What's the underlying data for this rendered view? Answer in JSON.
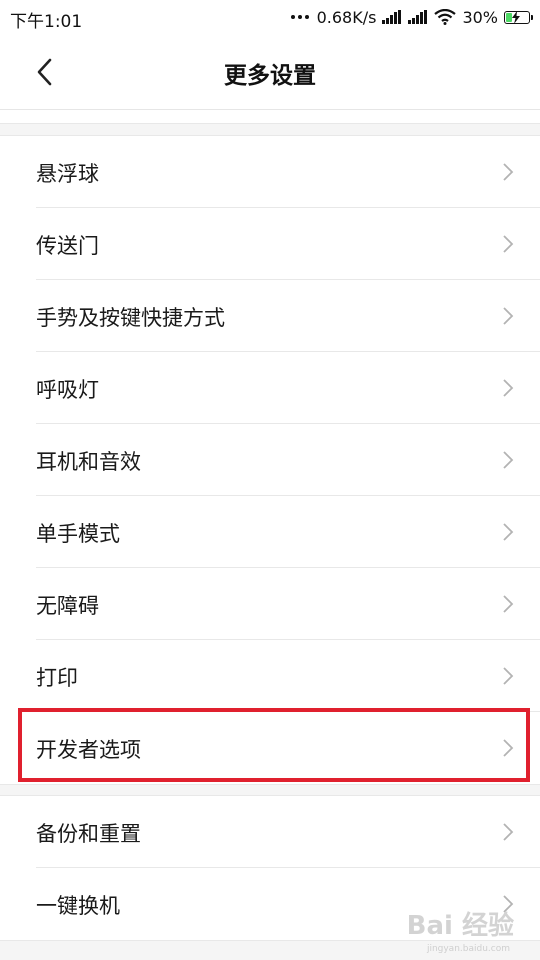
{
  "status_bar": {
    "time": "下午1:01",
    "network_speed": "0.68K/s",
    "battery_percent": "30%",
    "battery_level": 0.3,
    "battery_color": "#4cd964",
    "icons": [
      "more-dots-icon",
      "signal-icon",
      "signal-icon",
      "wifi-icon",
      "battery-charging-icon"
    ]
  },
  "header": {
    "back_icon": "chevron-left-icon",
    "title": "更多设置"
  },
  "groups": [
    {
      "items": [
        {
          "id": "floating-ball",
          "label": "悬浮球"
        },
        {
          "id": "portal",
          "label": "传送门"
        },
        {
          "id": "gestures-shortcuts",
          "label": "手势及按键快捷方式"
        },
        {
          "id": "breathing-light",
          "label": "呼吸灯"
        },
        {
          "id": "headphones-audio",
          "label": "耳机和音效"
        },
        {
          "id": "one-hand-mode",
          "label": "单手模式"
        },
        {
          "id": "accessibility",
          "label": "无障碍"
        },
        {
          "id": "print",
          "label": "打印"
        },
        {
          "id": "developer-options",
          "label": "开发者选项"
        }
      ]
    },
    {
      "items": [
        {
          "id": "backup-reset",
          "label": "备份和重置"
        },
        {
          "id": "mi-mover",
          "label": "一键换机"
        }
      ]
    }
  ],
  "highlight": {
    "target": "developer-options",
    "color": "#e0202e"
  },
  "watermark": {
    "text": "Bai 经验",
    "sub": "jingyan.baidu.com"
  }
}
